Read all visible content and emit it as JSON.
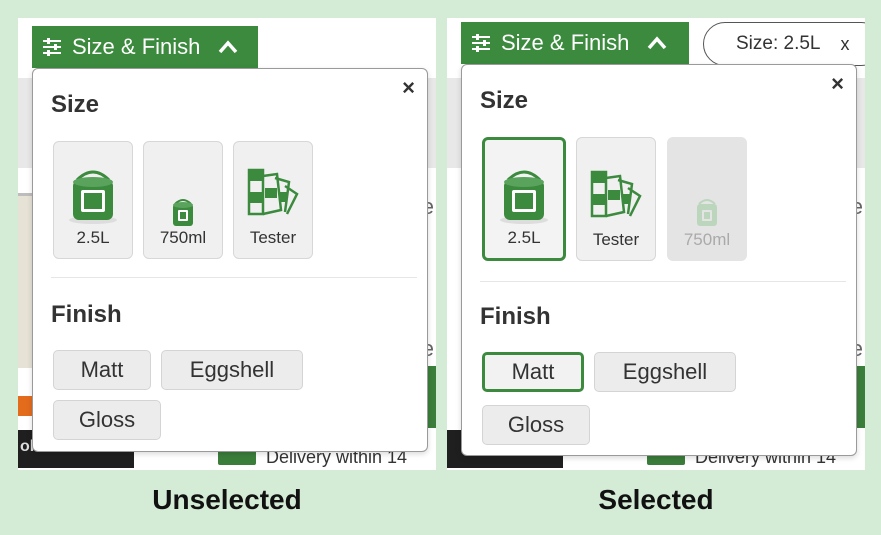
{
  "accent_color": "#3b8a3e",
  "background_color": "#d4ebd6",
  "left": {
    "caption": "Unselected",
    "filter_button_label": "Size & Finish",
    "size_heading": "Size",
    "finish_heading": "Finish",
    "close_symbol": "×",
    "background_delivery_text": "Delivery within 14",
    "background_dark_bar_text": "ol Walls",
    "background_letter": "e",
    "sizes": [
      {
        "label": "2.5L",
        "icon": "large-paint-tin-icon",
        "state": "unselected"
      },
      {
        "label": "750ml",
        "icon": "small-paint-tin-icon",
        "state": "unselected"
      },
      {
        "label": "Tester",
        "icon": "colour-swatch-fan-icon",
        "state": "unselected"
      }
    ],
    "finishes": [
      {
        "label": "Matt",
        "state": "unselected"
      },
      {
        "label": "Eggshell",
        "state": "unselected"
      },
      {
        "label": "Gloss",
        "state": "unselected"
      }
    ]
  },
  "right": {
    "caption": "Selected",
    "filter_button_label": "Size & Finish",
    "active_filter_chip": "Size: 2.5L",
    "chip_close_symbol": "x",
    "size_heading": "Size",
    "finish_heading": "Finish",
    "close_symbol": "×",
    "background_delivery_text": "Delivery within 14",
    "background_letter": "e",
    "sizes": [
      {
        "label": "2.5L",
        "icon": "large-paint-tin-icon",
        "state": "selected"
      },
      {
        "label": "Tester",
        "icon": "colour-swatch-fan-icon",
        "state": "unselected"
      },
      {
        "label": "750ml",
        "icon": "small-paint-tin-icon",
        "state": "disabled"
      }
    ],
    "finishes": [
      {
        "label": "Matt",
        "state": "selected"
      },
      {
        "label": "Eggshell",
        "state": "unselected"
      },
      {
        "label": "Gloss",
        "state": "unselected"
      }
    ]
  }
}
